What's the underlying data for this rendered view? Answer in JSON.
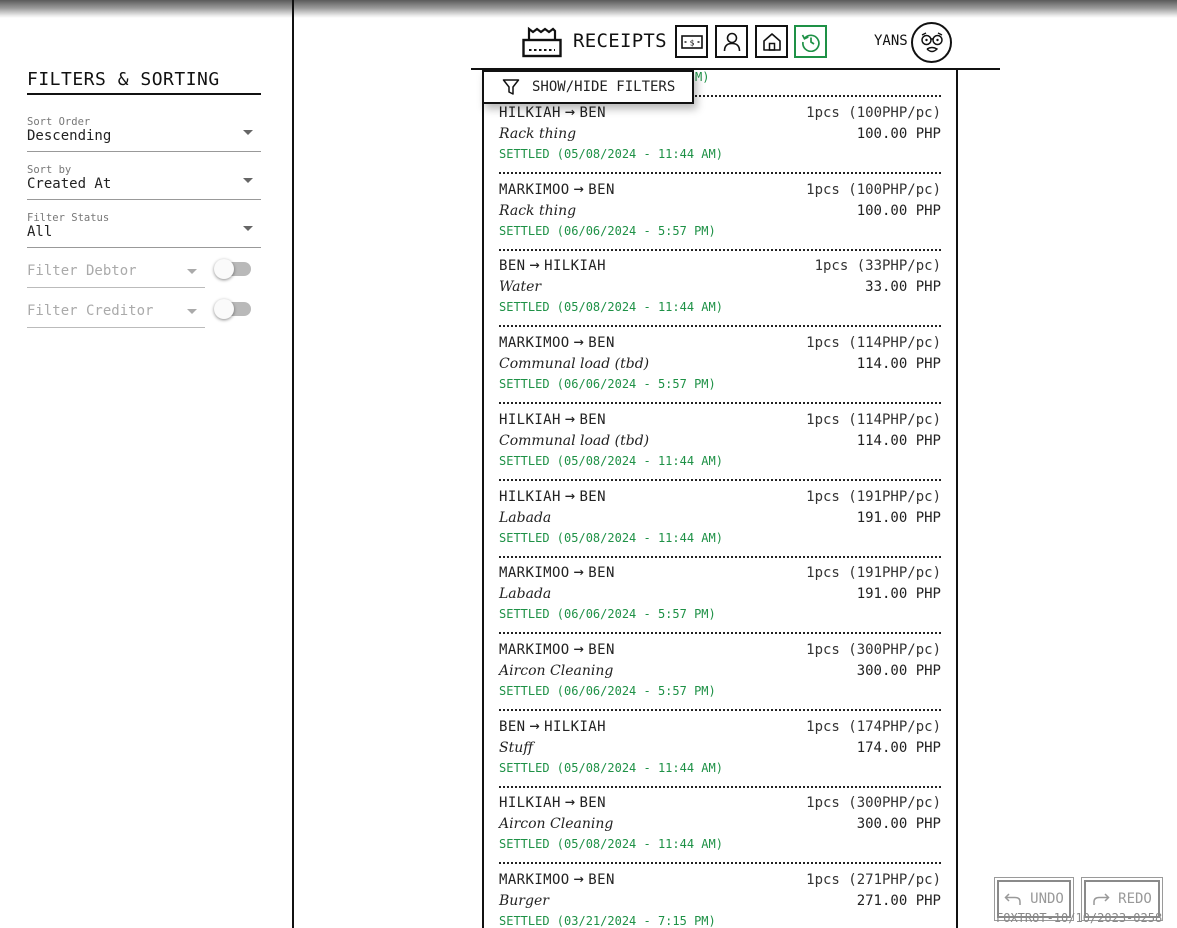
{
  "sidebar": {
    "title": "FILTERS & SORTING",
    "sort_order": {
      "label": "Sort Order",
      "value": "Descending"
    },
    "sort_by": {
      "label": "Sort by",
      "value": "Created At"
    },
    "filter_status": {
      "label": "Filter Status",
      "value": "All"
    },
    "filter_debtor": {
      "placeholder": "Filter Debtor",
      "toggle_on": false
    },
    "filter_creditor": {
      "placeholder": "Filter Creditor",
      "toggle_on": false
    }
  },
  "header": {
    "title": "RECEIPTS",
    "user_name": "YANS",
    "nav_icons": [
      "money-icon",
      "person-icon",
      "home-icon",
      "history-icon"
    ],
    "active_nav": "history-icon"
  },
  "filters_button": {
    "label": "SHOW/HIDE FILTERS"
  },
  "partial_status_tail": "M)",
  "receipts": [
    {
      "from": "HILKIAH",
      "to": "BEN",
      "qty": "1pcs (100PHP/pc)",
      "item": "Rack thing",
      "amount": "100.00 PHP",
      "status": "SETTLED (05/08/2024 - 11:44 AM)"
    },
    {
      "from": "MARKIMOO",
      "to": "BEN",
      "qty": "1pcs (100PHP/pc)",
      "item": "Rack thing",
      "amount": "100.00 PHP",
      "status": "SETTLED (06/06/2024 - 5:57 PM)"
    },
    {
      "from": "BEN",
      "to": "HILKIAH",
      "qty": "1pcs (33PHP/pc)",
      "item": "Water",
      "amount": "33.00 PHP",
      "status": "SETTLED (05/08/2024 - 11:44 AM)"
    },
    {
      "from": "MARKIMOO",
      "to": "BEN",
      "qty": "1pcs (114PHP/pc)",
      "item": "Communal load (tbd)",
      "amount": "114.00 PHP",
      "status": "SETTLED (06/06/2024 - 5:57 PM)"
    },
    {
      "from": "HILKIAH",
      "to": "BEN",
      "qty": "1pcs (114PHP/pc)",
      "item": "Communal load (tbd)",
      "amount": "114.00 PHP",
      "status": "SETTLED (05/08/2024 - 11:44 AM)"
    },
    {
      "from": "HILKIAH",
      "to": "BEN",
      "qty": "1pcs (191PHP/pc)",
      "item": "Labada",
      "amount": "191.00 PHP",
      "status": "SETTLED (05/08/2024 - 11:44 AM)"
    },
    {
      "from": "MARKIMOO",
      "to": "BEN",
      "qty": "1pcs (191PHP/pc)",
      "item": "Labada",
      "amount": "191.00 PHP",
      "status": "SETTLED (06/06/2024 - 5:57 PM)"
    },
    {
      "from": "MARKIMOO",
      "to": "BEN",
      "qty": "1pcs (300PHP/pc)",
      "item": "Aircon Cleaning",
      "amount": "300.00 PHP",
      "status": "SETTLED (06/06/2024 - 5:57 PM)"
    },
    {
      "from": "BEN",
      "to": "HILKIAH",
      "qty": "1pcs (174PHP/pc)",
      "item": "Stuff",
      "amount": "174.00 PHP",
      "status": "SETTLED (05/08/2024 - 11:44 AM)"
    },
    {
      "from": "HILKIAH",
      "to": "BEN",
      "qty": "1pcs (300PHP/pc)",
      "item": "Aircon Cleaning",
      "amount": "300.00 PHP",
      "status": "SETTLED (05/08/2024 - 11:44 AM)"
    },
    {
      "from": "MARKIMOO",
      "to": "BEN",
      "qty": "1pcs (271PHP/pc)",
      "item": "Burger",
      "amount": "271.00 PHP",
      "status": "SETTLED (03/21/2024 - 7:15 PM)"
    }
  ],
  "undo_label": "UNDO",
  "redo_label": "REDO",
  "version": "FOXTROT-10/10/2023-0258",
  "colors": {
    "settled": "#1e9146",
    "active_nav": "#1e9146"
  }
}
